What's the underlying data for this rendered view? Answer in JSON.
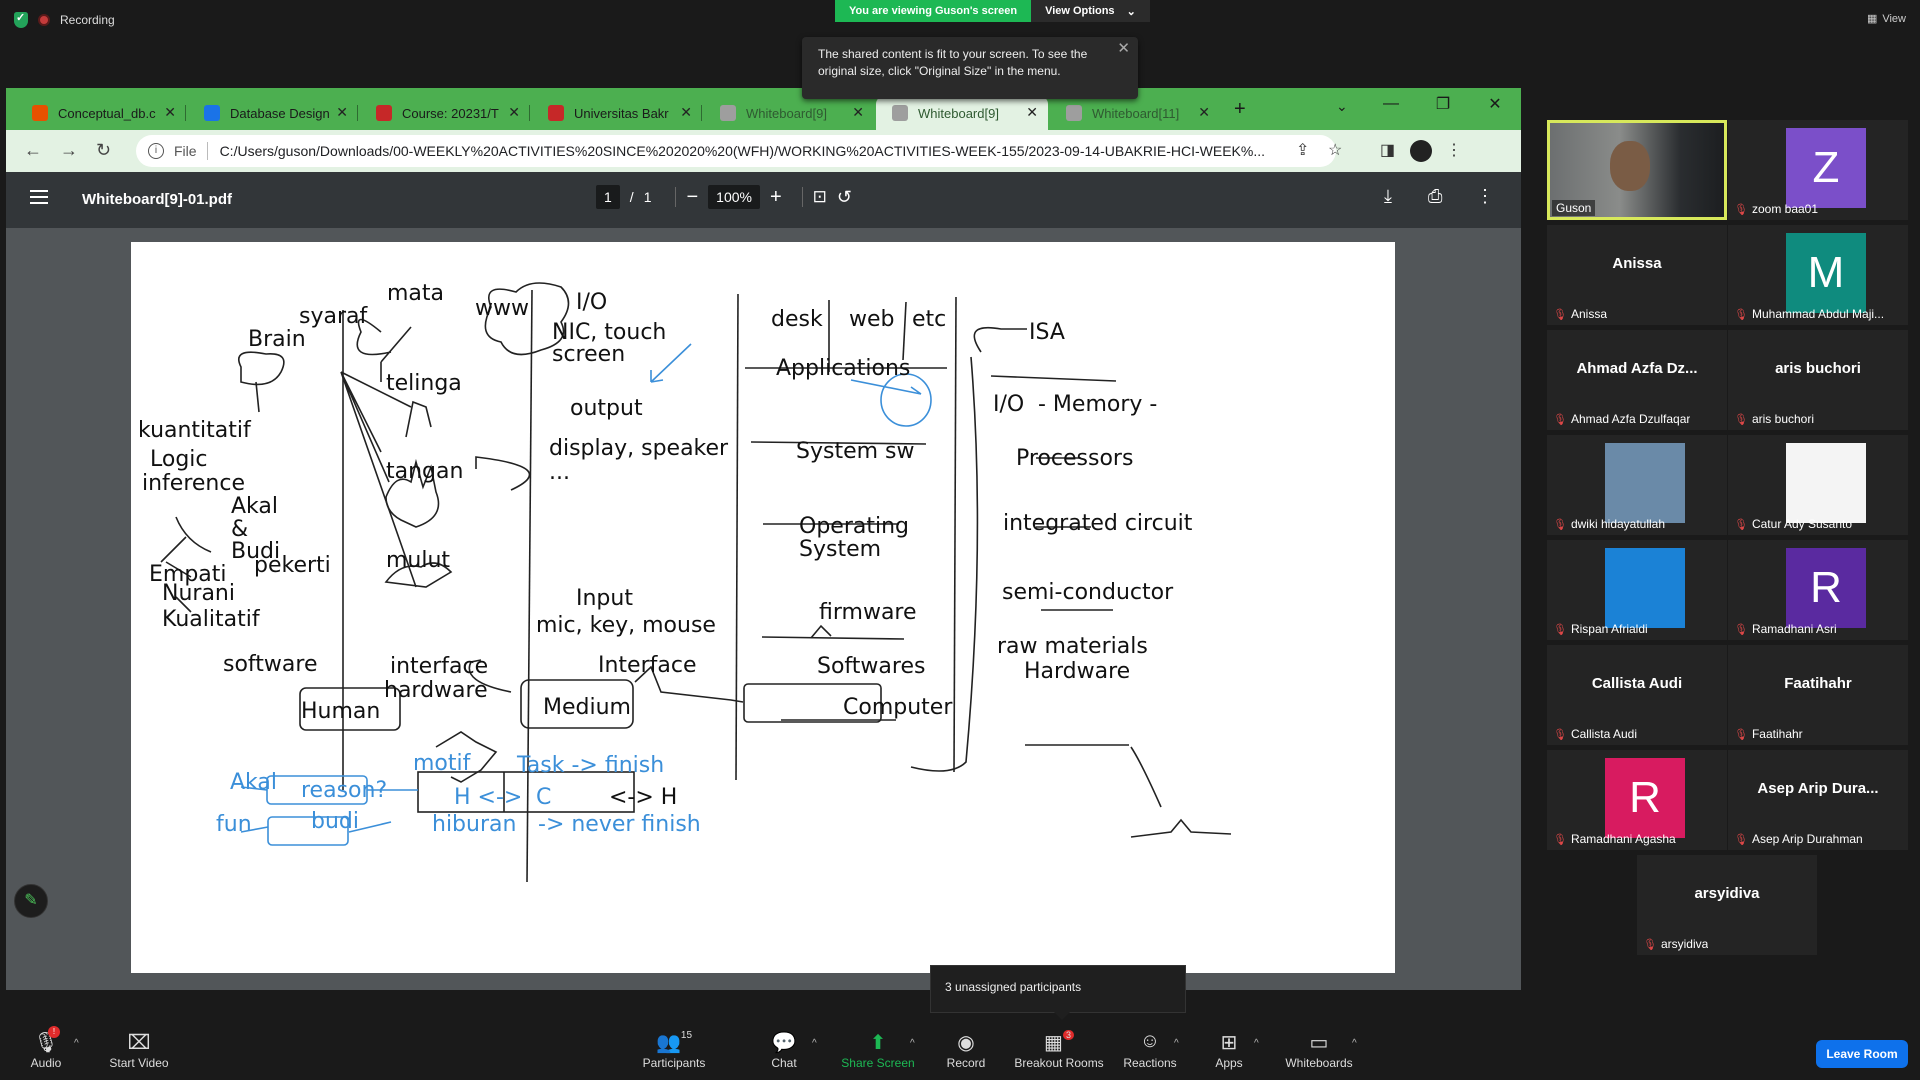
{
  "zoom": {
    "recording_label": "Recording",
    "viewing_banner": "You are viewing Guson's screen",
    "view_options": "View Options",
    "view_label": "View",
    "tooltip": "The shared content is fit to your screen. To see the original size, click \"Original Size\" in the menu.",
    "unassigned": "3 unassigned participants",
    "leave_room": "Leave Room",
    "toolbar": {
      "audio": "Audio",
      "start_video": "Start Video",
      "participants": "Participants",
      "participants_count": "15",
      "chat": "Chat",
      "share_screen": "Share Screen",
      "record": "Record",
      "breakout_rooms": "Breakout Rooms",
      "breakout_count": "3",
      "reactions": "Reactions",
      "apps": "Apps",
      "whiteboards": "Whiteboards"
    }
  },
  "browser": {
    "tabs": [
      {
        "label": "Conceptual_db.c",
        "color": "#e65100"
      },
      {
        "label": "Database Design",
        "color": "#1a73e8"
      },
      {
        "label": "Course: 20231/T",
        "color": "#c62828"
      },
      {
        "label": "Universitas Bakr",
        "color": "#c62828"
      },
      {
        "label": "Whiteboard[9]",
        "color": "#9e9e9e"
      },
      {
        "label": "Whiteboard[9]",
        "color": "#9e9e9e"
      },
      {
        "label": "Whiteboard[11]",
        "color": "#9e9e9e"
      }
    ],
    "file_label": "File",
    "url": "C:/Users/guson/Downloads/00-WEEKLY%20ACTIVITIES%20SINCE%202020%20(WFH)/WORKING%20ACTIVITIES-WEEK-155/2023-09-14-UBAKRIE-HCI-WEEK%..."
  },
  "pdf": {
    "filename": "Whiteboard[9]-01.pdf",
    "page_current": "1",
    "page_sep": "/",
    "page_total": "1",
    "zoom": "100%"
  },
  "whiteboard": {
    "black": [
      "mata",
      "syaraf",
      "www",
      "I/O",
      "NIC, touch",
      "screen",
      "Brain",
      "telinga",
      "output",
      "kuantitatif",
      "Logic",
      "inference",
      "tangan",
      "display, speaker",
      "...",
      "Akal",
      "&",
      "Budi",
      "pekerti",
      "mulut",
      "Empati",
      "Nurani",
      "Kualitatif",
      "Input",
      "mic, key, mouse",
      "software",
      "interface",
      "hardware",
      "Interface",
      "Human",
      "Medium",
      "desk",
      "web",
      "etc",
      "Applications",
      "System sw",
      "Operating",
      "System",
      "firmware",
      "Softwares",
      "Computer",
      "ISA",
      "I/O",
      "- Memory -",
      "Processors",
      "integrated circuit",
      "semi-conductor",
      "raw materials",
      "Hardware",
      "<-> H"
    ],
    "blue": [
      "motif",
      "Task -> finish",
      "Akal",
      "reason?",
      "H <->",
      "C",
      "fun",
      "budi",
      "hiburan",
      "-> never finish"
    ]
  },
  "participants": [
    {
      "name": "Guson",
      "type": "video",
      "active": true
    },
    {
      "name": "zoom baa01",
      "type": "avatar",
      "initial": "Z",
      "color": "#7b4fc9"
    },
    {
      "name": "Anissa",
      "type": "name",
      "display": "Anissa"
    },
    {
      "name": "Muhammad Abdul Maji...",
      "type": "avatar",
      "initial": "M",
      "color": "#0f8b7e"
    },
    {
      "name": "Ahmad Azfa Dzulfaqar",
      "type": "name",
      "display": "Ahmad Azfa Dz..."
    },
    {
      "name": "aris buchori",
      "type": "name",
      "display": "aris buchori"
    },
    {
      "name": "dwiki hidayatullah",
      "type": "photo",
      "color": "#6a8aa8"
    },
    {
      "name": "Catur Ady Susanto",
      "type": "photo",
      "color": "#f4f4f4"
    },
    {
      "name": "Rispan Afrialdi",
      "type": "photo",
      "color": "#1b82d6"
    },
    {
      "name": "Ramadhani Asri",
      "type": "avatar",
      "initial": "R",
      "color": "#5a2aa0"
    },
    {
      "name": "Callista Audi",
      "type": "name",
      "display": "Callista Audi"
    },
    {
      "name": "Faatihahr",
      "type": "name",
      "display": "Faatihahr"
    },
    {
      "name": "Ramadhani Agasha",
      "type": "avatar",
      "initial": "R",
      "color": "#d81b60"
    },
    {
      "name": "Asep Arip Durahman",
      "type": "name",
      "display": "Asep Arip Dura..."
    },
    {
      "name": "arsyidiva",
      "type": "name",
      "display": "arsyidiva"
    }
  ]
}
